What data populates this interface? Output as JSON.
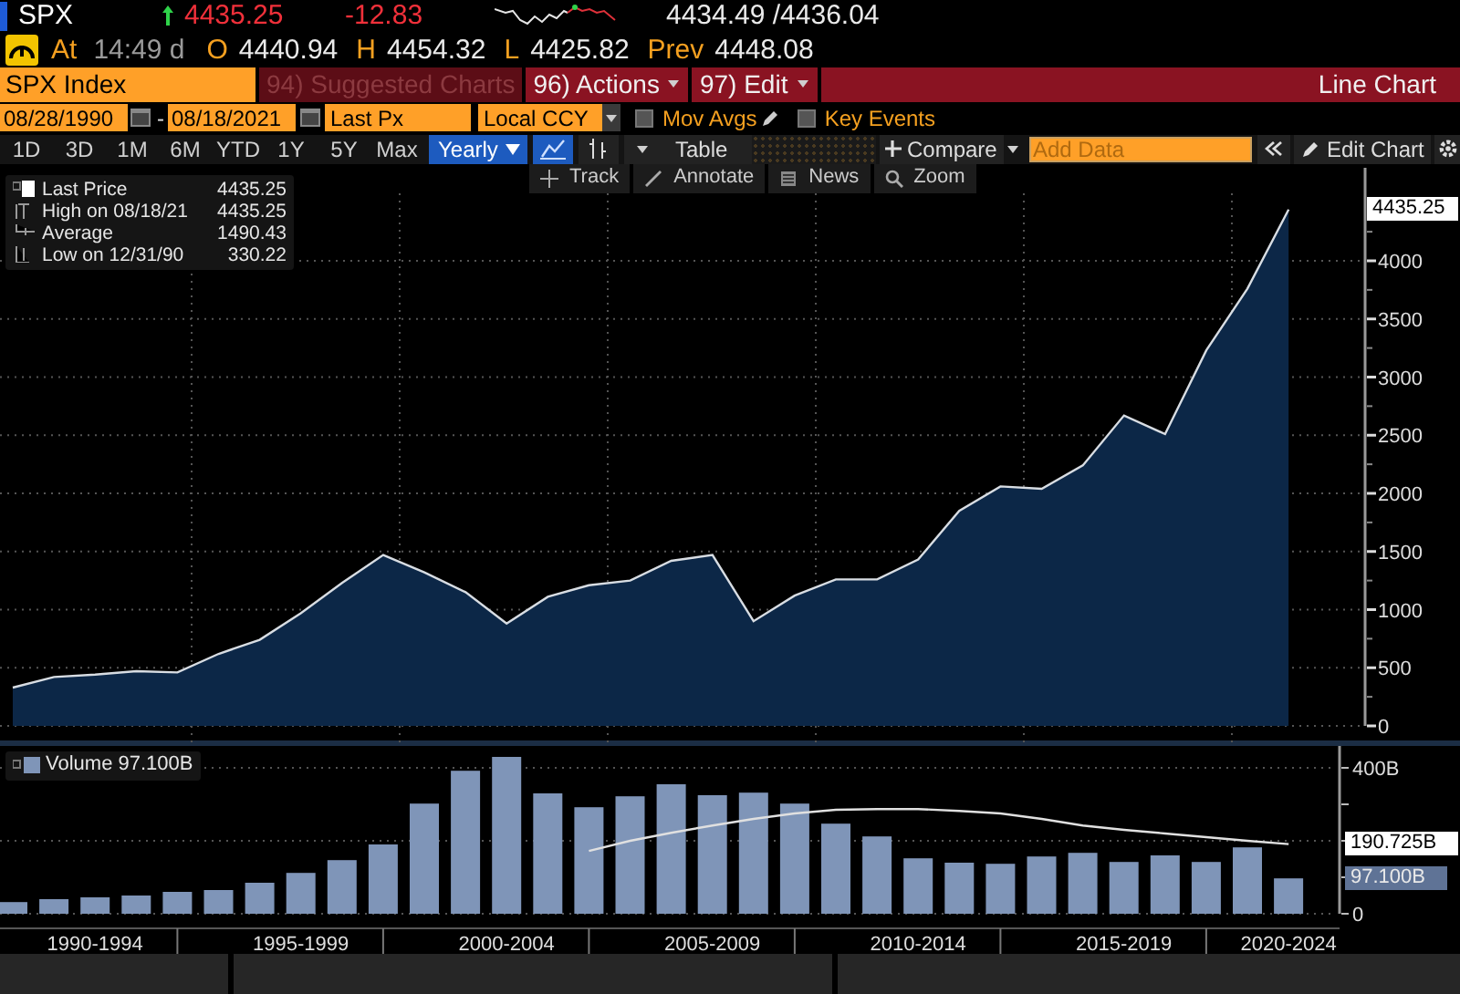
{
  "header": {
    "ticker": "SPX",
    "arrow_up": true,
    "last": "4435.25",
    "change": "-12.83",
    "bid_ask": "4434.49 /4436.04"
  },
  "quote_line": {
    "at_label": "At",
    "time": "14:49 d",
    "fields": [
      {
        "label": "O",
        "value": "4440.94"
      },
      {
        "label": "H",
        "value": "4454.32"
      },
      {
        "label": "L",
        "value": "4425.82"
      },
      {
        "label": "Prev",
        "value": "4448.08"
      }
    ]
  },
  "command_bar": {
    "security": "SPX Index",
    "menus": [
      {
        "label": "94) Suggested Charts",
        "disabled": true,
        "dropdown": false
      },
      {
        "label": "96) Actions",
        "disabled": false,
        "dropdown": true
      },
      {
        "label": "97) Edit",
        "disabled": false,
        "dropdown": true
      }
    ],
    "chart_type": "Line Chart"
  },
  "settings_bar": {
    "start_date": "08/28/1990",
    "date_separator": "-",
    "end_date": "08/18/2021",
    "field": "Last Px",
    "currency": "Local CCY",
    "toggles": [
      {
        "kind": "editable",
        "label": "Mov Avgs",
        "checked": false
      },
      {
        "kind": "plain",
        "label": "Key Events",
        "checked": false
      }
    ]
  },
  "periods": [
    {
      "label": "1D",
      "selected": false
    },
    {
      "label": "3D",
      "selected": false
    },
    {
      "label": "1M",
      "selected": false
    },
    {
      "label": "6M",
      "selected": false
    },
    {
      "label": "YTD",
      "selected": false
    },
    {
      "label": "1Y",
      "selected": false
    },
    {
      "label": "5Y",
      "selected": false
    },
    {
      "label": "Max",
      "selected": false
    }
  ],
  "periodicity": {
    "label": "Yearly",
    "selected": true
  },
  "view_buttons": [
    {
      "kind": "line",
      "selected": true
    },
    {
      "kind": "bars",
      "selected": false
    }
  ],
  "table_label": "Table",
  "compare_label": "Compare",
  "add_data": {
    "placeholder": "Add Data"
  },
  "edit_chart_label": "Edit Chart",
  "tools": [
    {
      "kind": "track",
      "label": "Track"
    },
    {
      "kind": "annotate",
      "label": "Annotate"
    },
    {
      "kind": "news",
      "label": "News"
    },
    {
      "kind": "zoom",
      "label": "Zoom"
    }
  ],
  "legend": [
    {
      "kind": "last",
      "label": "Last Price",
      "value": "4435.25"
    },
    {
      "kind": "high",
      "label": "High on 08/18/21",
      "value": "4435.25"
    },
    {
      "kind": "average",
      "label": "Average",
      "value": "1490.43"
    },
    {
      "kind": "low",
      "label": "Low on 12/31/90",
      "value": "330.22"
    }
  ],
  "price_chart": {
    "last_badge": "4435.25",
    "chart_data": {
      "type": "area",
      "ylim": [
        0,
        4800
      ],
      "yticks": [
        0,
        500,
        1000,
        1500,
        2000,
        2500,
        3000,
        3500,
        4000
      ],
      "grid": true,
      "series": [
        {
          "color": "#0c2747",
          "values": [
            330,
            420,
            440,
            470,
            460,
            620,
            740,
            970,
            1230,
            1470,
            1320,
            1150,
            880,
            1110,
            1210,
            1250,
            1420,
            1470,
            900,
            1120,
            1260,
            1260,
            1430,
            1850,
            2060,
            2040,
            2240,
            2670,
            2510,
            3230,
            3760,
            4440
          ]
        }
      ]
    }
  },
  "volume_chart": {
    "legend_value": "97.100B",
    "average_badge": "190.725B",
    "last_badge": "97.100B",
    "chart_data": {
      "type": "bar",
      "ylim": [
        0,
        460
      ],
      "yticks": [
        {
          "value": 0,
          "label": "0"
        },
        {
          "value": 400,
          "label": "400B"
        }
      ],
      "grid": true,
      "categories": [
        null,
        null,
        "1990-1994",
        null,
        null,
        null,
        null,
        "1995-1999",
        null,
        null,
        null,
        null,
        "2000-2004",
        null,
        null,
        null,
        null,
        "2005-2009",
        null,
        null,
        null,
        null,
        "2010-2014",
        null,
        null,
        null,
        null,
        "2015-2019",
        null,
        null,
        null,
        "2020-2024"
      ],
      "series": [
        {
          "name": "Volume",
          "color": "#7f95b8",
          "values": [
            32,
            40,
            45,
            50,
            60,
            65,
            85,
            112,
            147,
            190,
            302,
            392,
            430,
            330,
            292,
            322,
            355,
            325,
            332,
            302,
            247,
            212,
            152,
            140,
            137,
            157,
            167,
            142,
            160,
            142,
            182,
            97
          ]
        },
        {
          "type": "line",
          "color": "#e0e0e0",
          "values": [
            null,
            null,
            null,
            null,
            null,
            null,
            null,
            null,
            null,
            null,
            null,
            null,
            null,
            null,
            172,
            200,
            222,
            242,
            260,
            275,
            285,
            287,
            287,
            282,
            275,
            260,
            242,
            230,
            220,
            210,
            200,
            191
          ]
        }
      ]
    }
  }
}
